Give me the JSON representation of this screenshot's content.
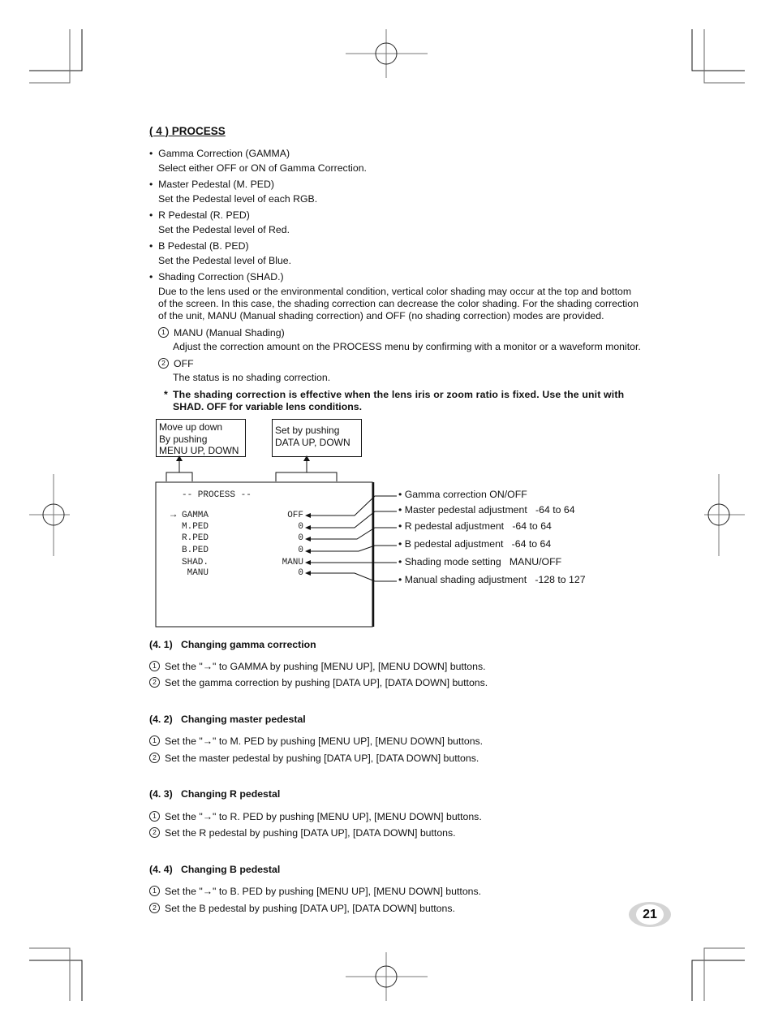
{
  "section": {
    "title": "( 4 )   PROCESS",
    "items": [
      {
        "label": "Gamma Correction (GAMMA)",
        "desc": "Select either OFF or ON of Gamma Correction."
      },
      {
        "label": "Master Pedestal (M. PED)",
        "desc": "Set the Pedestal level of each RGB."
      },
      {
        "label": "R Pedestal (R. PED)",
        "desc": "Set the Pedestal level of Red."
      },
      {
        "label": "B Pedestal (B. PED)",
        "desc": "Set the Pedestal level of Blue."
      },
      {
        "label": "Shading Correction (SHAD.)",
        "desc_lines": [
          "Due to the lens used or the environmental condition, vertical color shading may occur at the top and bottom",
          "of the screen. In this case, the shading correction can decrease the color shading. For the shading correction",
          "of the unit, MANU (Manual shading correction) and OFF (no shading correction) modes are provided."
        ]
      }
    ],
    "modes": [
      {
        "num": "1",
        "label": "MANU (Manual Shading)",
        "desc": "Adjust the correction amount on the PROCESS menu by confirming with a monitor or a waveform monitor."
      },
      {
        "num": "2",
        "label": "OFF",
        "desc": "The status is no shading correction."
      }
    ],
    "note": {
      "marker": "*",
      "lines": [
        "The shading correction is effective when the lens iris or zoom ratio is fixed. Use the unit with",
        "SHAD. OFF for variable lens conditions."
      ]
    }
  },
  "diagram": {
    "menu_callout": [
      "Move up down",
      "By pushing",
      "MENU UP, DOWN"
    ],
    "data_callout": [
      "Set by pushing",
      "DATA UP, DOWN"
    ],
    "screen_title": "-- PROCESS --",
    "cursor": "→",
    "rows": [
      {
        "name": "GAMMA",
        "value": "OFF",
        "annotation": "• Gamma correction ON/OFF"
      },
      {
        "name": "M.PED",
        "value": "0",
        "annotation": "• Master pedestal adjustment   -64 to 64"
      },
      {
        "name": "R.PED",
        "value": "0",
        "annotation": "• R pedestal adjustment   -64 to 64"
      },
      {
        "name": "B.PED",
        "value": "0",
        "annotation": "• B pedestal adjustment   -64 to 64"
      },
      {
        "name": "SHAD.",
        "value": "MANU",
        "annotation": "• Shading mode setting   MANU/OFF"
      },
      {
        "name": " MANU",
        "value": "0",
        "annotation": "• Manual shading adjustment   -128 to 127"
      }
    ]
  },
  "subsections": [
    {
      "title": "(4. 1)   Changing gamma correction",
      "steps": [
        {
          "num": "1",
          "text": "Set the \"→\" to GAMMA by pushing [MENU UP], [MENU DOWN] buttons."
        },
        {
          "num": "2",
          "text": "Set the gamma correction by pushing [DATA UP], [DATA DOWN] buttons."
        }
      ]
    },
    {
      "title": "(4. 2)   Changing master pedestal",
      "steps": [
        {
          "num": "1",
          "text": "Set the \"→\" to M. PED by pushing [MENU UP], [MENU DOWN] buttons."
        },
        {
          "num": "2",
          "text": "Set the master pedestal by pushing [DATA UP], [DATA DOWN] buttons."
        }
      ]
    },
    {
      "title": "(4. 3)   Changing R pedestal",
      "steps": [
        {
          "num": "1",
          "text": "Set the \"→\" to R. PED by pushing [MENU UP], [MENU DOWN] buttons."
        },
        {
          "num": "2",
          "text": "Set the R pedestal by pushing [DATA UP], [DATA DOWN] buttons."
        }
      ]
    },
    {
      "title": "(4. 4)   Changing B pedestal",
      "steps": [
        {
          "num": "1",
          "text": "Set the \"→\" to B. PED by pushing [MENU UP], [MENU DOWN] buttons."
        },
        {
          "num": "2",
          "text": "Set the B pedestal by pushing [DATA UP], [DATA DOWN] buttons."
        }
      ]
    }
  ],
  "page_number": "21"
}
